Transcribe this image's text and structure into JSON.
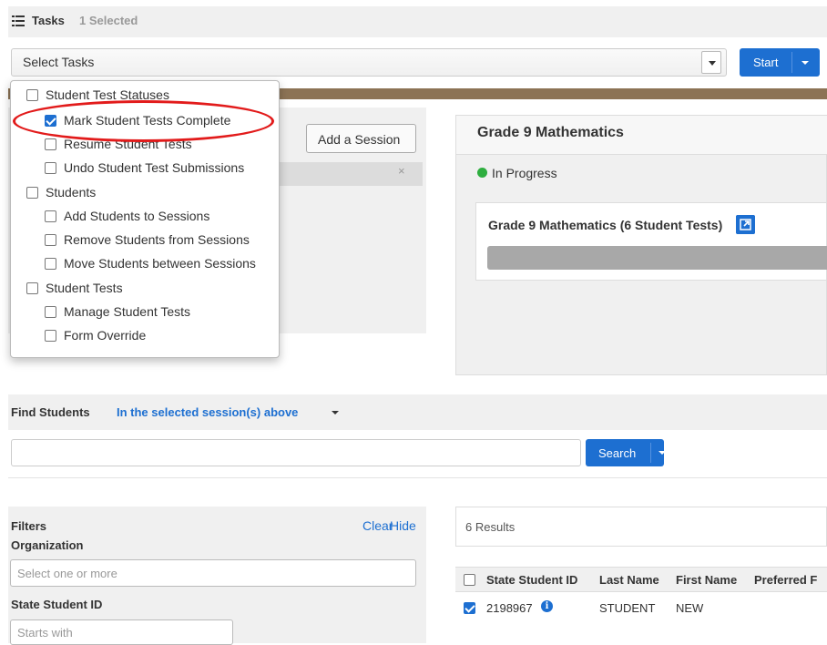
{
  "tasks_header": {
    "title": "Tasks",
    "selected": "1 Selected"
  },
  "task_select": {
    "value": "Select Tasks"
  },
  "start_button": {
    "label": "Start"
  },
  "task_menu": {
    "items": [
      {
        "label": "Student Test Statuses",
        "checked": false,
        "level": 0
      },
      {
        "label": "Mark Student Tests Complete",
        "checked": true,
        "level": 1
      },
      {
        "label": "Resume Student Tests",
        "checked": false,
        "level": 1
      },
      {
        "label": "Undo Student Test Submissions",
        "checked": false,
        "level": 1
      },
      {
        "label": "Students",
        "checked": false,
        "level": 0
      },
      {
        "label": "Add Students to Sessions",
        "checked": false,
        "level": 1
      },
      {
        "label": "Remove Students from Sessions",
        "checked": false,
        "level": 1
      },
      {
        "label": "Move Students between Sessions",
        "checked": false,
        "level": 1
      },
      {
        "label": "Student Tests",
        "checked": false,
        "level": 0
      },
      {
        "label": "Manage Student Tests",
        "checked": false,
        "level": 1
      },
      {
        "label": "Form Override",
        "checked": false,
        "level": 1
      }
    ],
    "highlight_color": "#e21b1b"
  },
  "sessions": {
    "add_session_label": "Add a Session",
    "close_glyph": "×"
  },
  "test_panel": {
    "title": "Grade 9 Mathematics",
    "status": "In Progress",
    "status_color": "#2eae3f",
    "card_title": "Grade 9 Mathematics (6 Student Tests)",
    "link_icon": "external-link-icon"
  },
  "find_students": {
    "label": "Find Students",
    "scope": "In the selected session(s) above",
    "search_value": "",
    "search_label": "Search"
  },
  "filters": {
    "title": "Filters",
    "clear": "Clear",
    "hide": "Hide",
    "organization_label": "Organization",
    "organization_placeholder": "Select one or more",
    "ssid_label": "State Student ID",
    "ssid_placeholder": "Starts with"
  },
  "results": {
    "count": "6 Results",
    "columns": [
      "State Student ID",
      "Last Name",
      "First Name",
      "Preferred F"
    ],
    "rows": [
      {
        "checked": true,
        "ssid": "2198967",
        "last": "STUDENT",
        "first": "NEW",
        "preferred": ""
      }
    ]
  },
  "colors": {
    "accent": "#1d6fd1",
    "band": "#8c7355"
  }
}
